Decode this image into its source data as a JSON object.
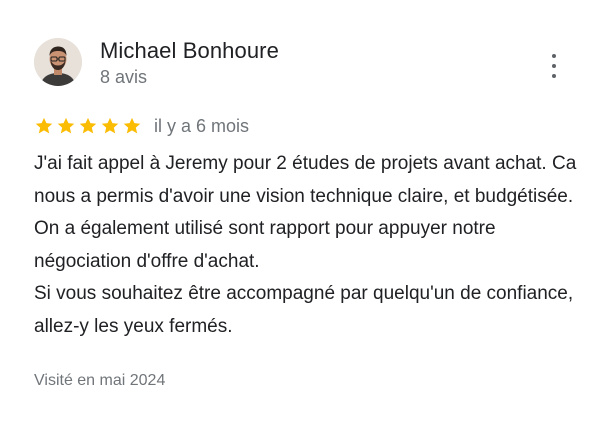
{
  "reviewer": {
    "name": "Michael Bonhoure",
    "review_count": "8 avis",
    "avatar_icon": "user-photo-icon"
  },
  "menu": {
    "icon": "more-vertical-icon"
  },
  "rating": {
    "stars": 5,
    "max_stars": 5,
    "star_color": "#fbbc04",
    "relative_date": "il y a 6 mois"
  },
  "review": {
    "paragraphs": [
      "J'ai fait appel à Jeremy pour 2 études de projets avant achat. Ca nous a permis d'avoir une vision technique claire, et budgétisée. On a également utilisé sont rapport pour appuyer notre négociation d'offre d'achat.",
      "Si vous souhaitez être accompagné par quelqu'un de confiance, allez-y les yeux fermés."
    ]
  },
  "visit": {
    "label": "Visité en mai 2024"
  },
  "colors": {
    "text_primary": "#202124",
    "text_secondary": "#70757a",
    "icon_grey": "#5f6368",
    "star_gold": "#fbbc04"
  }
}
